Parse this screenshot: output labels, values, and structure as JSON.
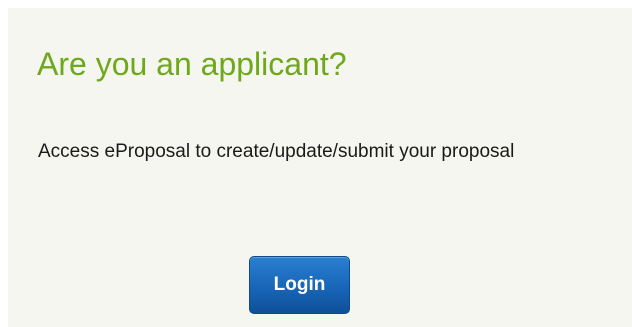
{
  "panel": {
    "title": "Are you an applicant?",
    "description": "Access eProposal to create/update/submit your proposal",
    "login_label": "Login"
  },
  "colors": {
    "panel_background": "#f4f6ef",
    "title_color": "#6fa81c",
    "button_color": "#1865b8"
  }
}
